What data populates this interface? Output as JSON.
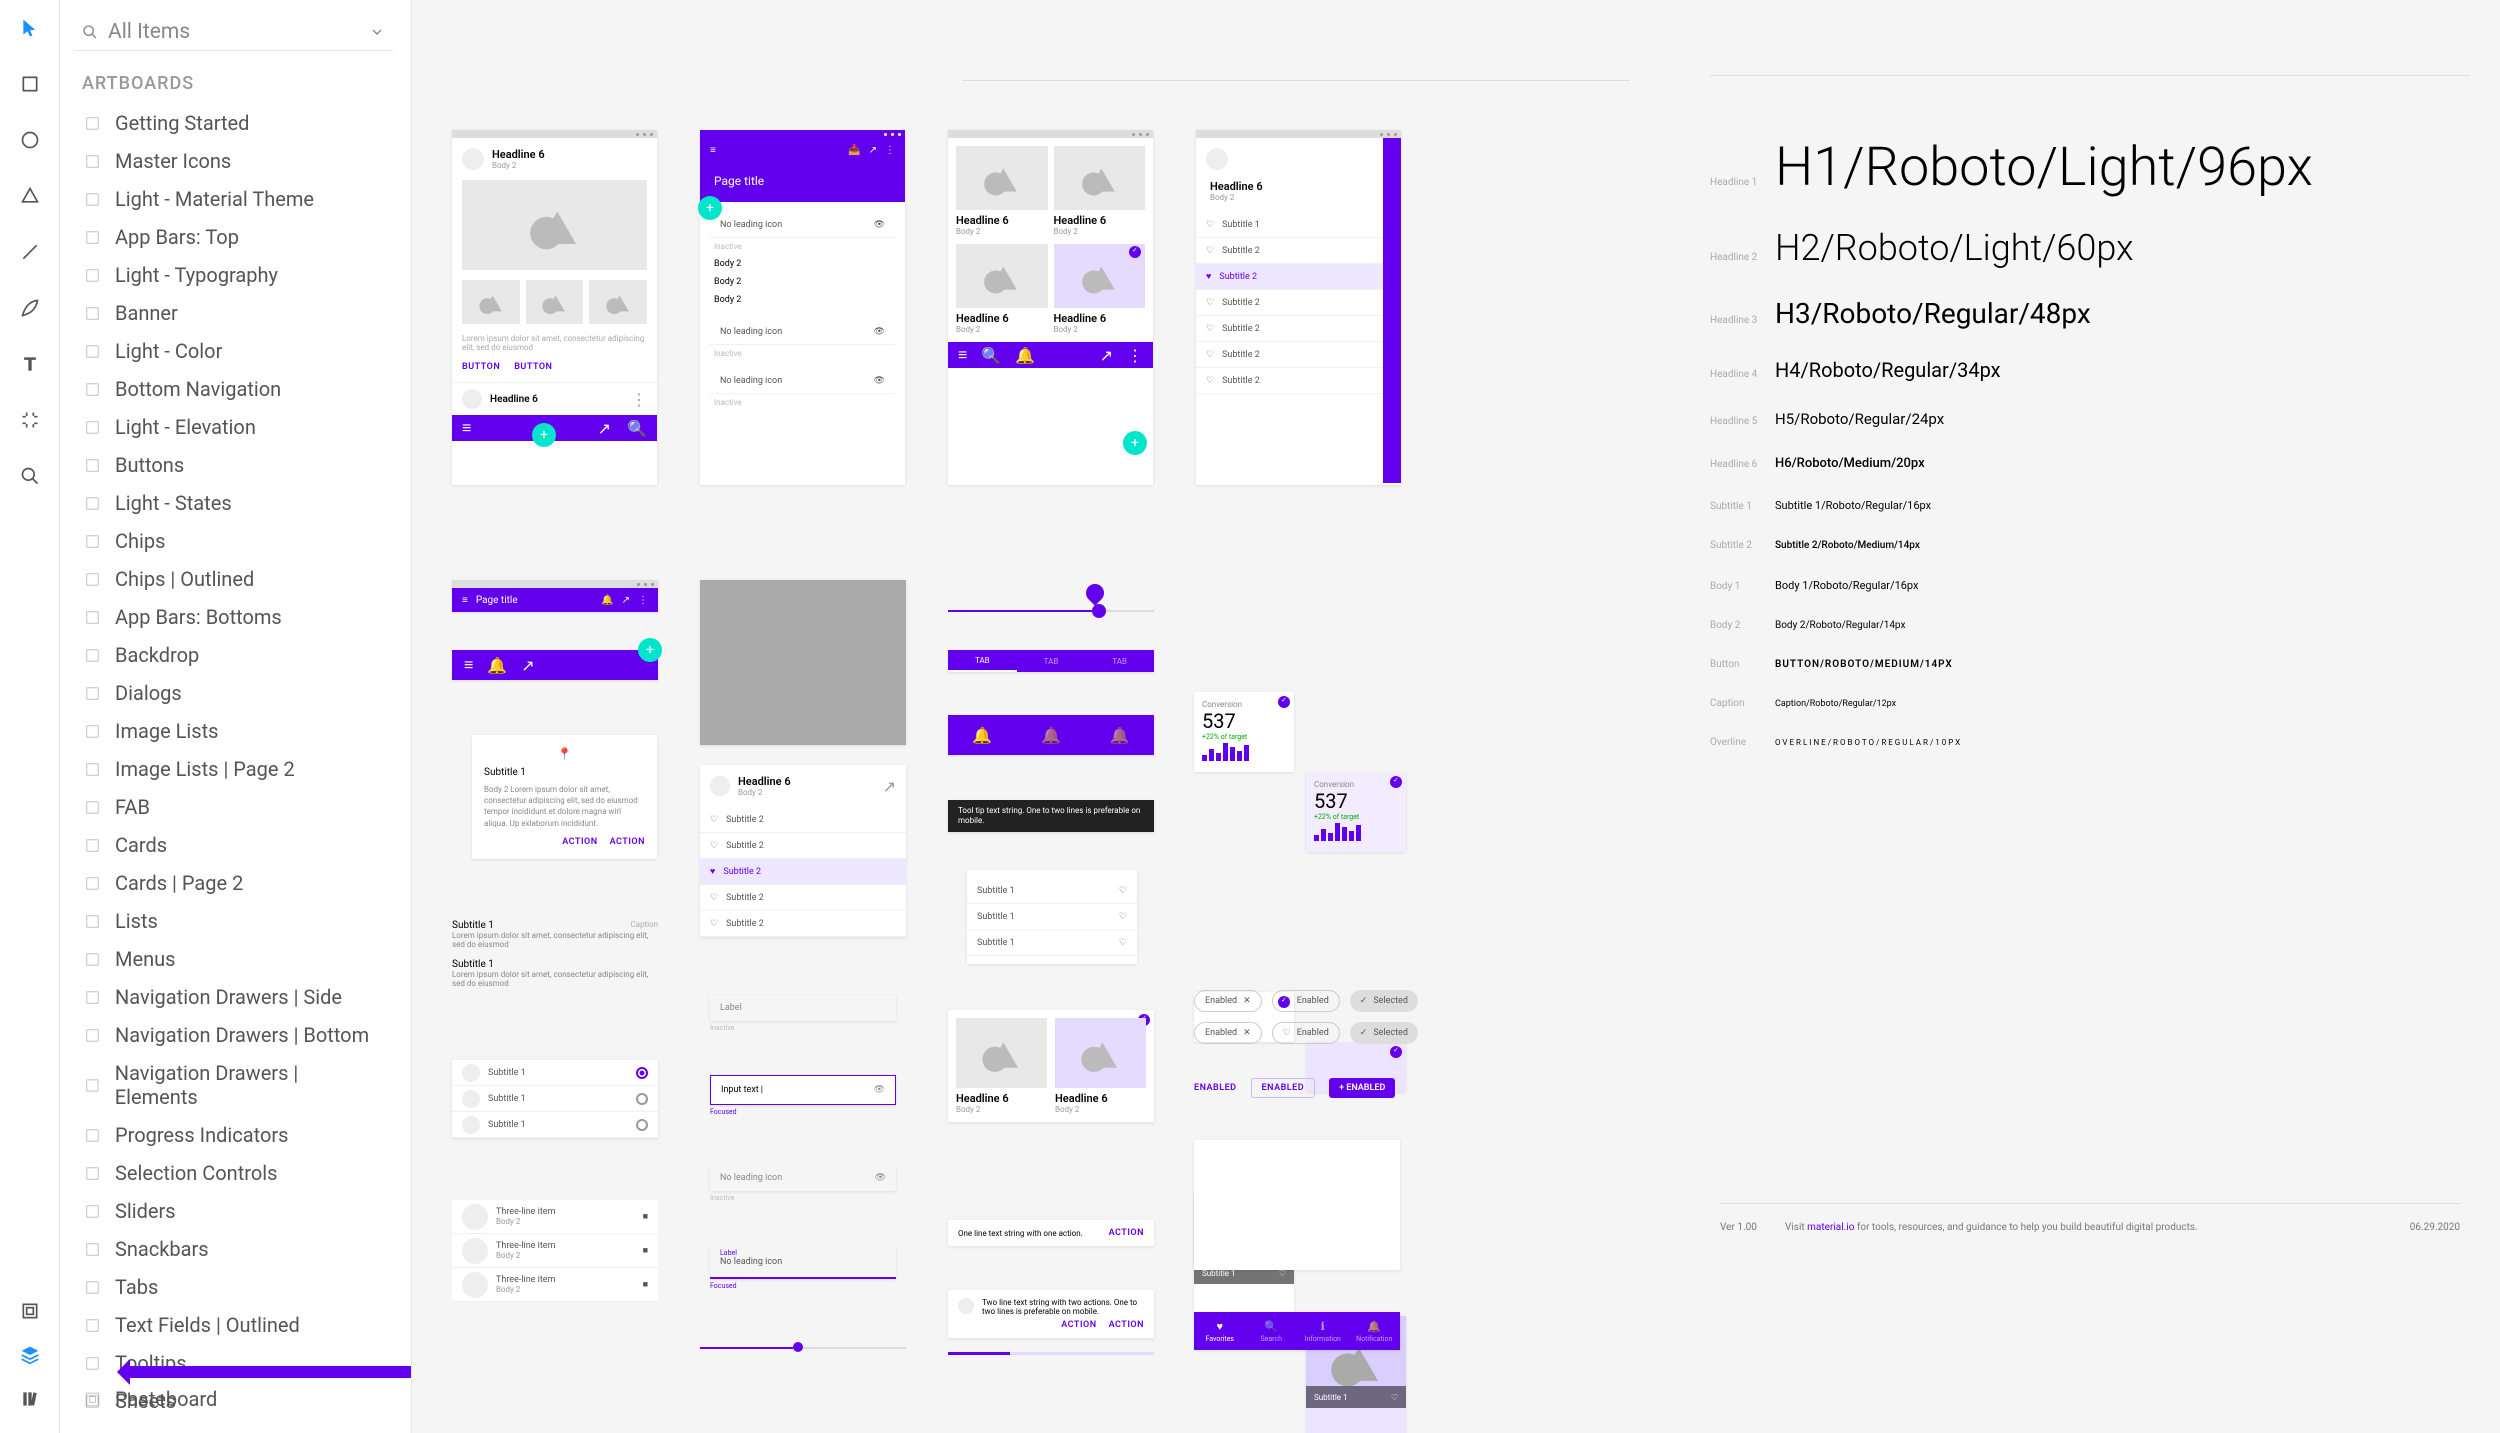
{
  "search_placeholder": "All Items",
  "section_label": "ARTBOARDS",
  "pasteboard_label": "Pasteboard",
  "artboards": [
    "Getting Started",
    "Master Icons",
    "Light - Material Theme",
    "App Bars: Top",
    "Light - Typography",
    "Banner",
    "Light - Color",
    "Bottom Navigation",
    "Light - Elevation",
    "Buttons",
    "Light - States",
    "Chips",
    "Chips | Outlined",
    "App Bars: Bottoms",
    "Backdrop",
    "Dialogs",
    "Image Lists",
    "Image Lists | Page 2",
    "FAB",
    "Cards",
    "Cards | Page 2",
    "Lists",
    "Menus",
    "Navigation Drawers | Side",
    "Navigation Drawers | Bottom",
    "Navigation Drawers | Elements",
    "Progress Indicators",
    "Selection Controls",
    "Sliders",
    "Snackbars",
    "Tabs",
    "Text Fields | Outlined",
    "Tooltips",
    "Sheets"
  ],
  "canvas": {
    "headline": "Headline 6",
    "body": "Body 2",
    "page_title": "Page title",
    "no_leading": "No leading icon",
    "inactive": "Inactive",
    "subtitle1": "Subtitle 1",
    "subtitle2": "Subtitle 2",
    "input_text": "Input text",
    "label": "Label",
    "focused": "Focused",
    "nolead": "No leading icon",
    "three_line": "Three-line item",
    "enabled": "Enabled",
    "selected": "Selected",
    "tab": "TAB",
    "action": "ACTION",
    "button": "BUTTON",
    "one_line_action": "One line text string with one action.",
    "two_line_action": "Two line text string with two actions. One to two lines is preferable on mobile.",
    "tooltip": "Tool tip text string. One to two lines is preferable on mobile.",
    "lorem": "Lorem ipsum dolor sit amet, consectetur adipiscing elit, sed do eiusmod",
    "lorem_long": "Body 2 Lorem ipsum dolor sit amet, consectetur adipiscing elit, sed do eiusmod tempor incididunt et dolore magna wirl aliqua. Up exlaborum incididunt.",
    "caption": "Caption",
    "conversion": "Conversion",
    "big_num": "537",
    "target": "+22% of target",
    "spark": [
      30,
      60,
      40,
      90,
      70,
      50,
      80
    ],
    "nav_items": [
      "Favorites",
      "Search",
      "Information",
      "Notification"
    ],
    "enabled_upper": "ENABLED",
    "plus_enabled": "+ ENABLED"
  },
  "typography": {
    "rows": [
      {
        "lab": "Headline 1",
        "txt": "H1/Roboto/Light/96px",
        "size": "54px",
        "weight": "300"
      },
      {
        "lab": "Headline 2",
        "txt": "H2/Roboto/Light/60px",
        "size": "36px",
        "weight": "300"
      },
      {
        "lab": "Headline 3",
        "txt": "H3/Roboto/Regular/48px",
        "size": "28px",
        "weight": "400"
      },
      {
        "lab": "Headline 4",
        "txt": "H4/Roboto/Regular/34px",
        "size": "20px",
        "weight": "400"
      },
      {
        "lab": "Headline 5",
        "txt": "H5/Roboto/Regular/24px",
        "size": "15px",
        "weight": "400"
      },
      {
        "lab": "Headline 6",
        "txt": "H6/Roboto/Medium/20px",
        "size": "13px",
        "weight": "500"
      },
      {
        "lab": "Subtitle 1",
        "txt": "Subtitle 1/Roboto/Regular/16px",
        "size": "11px",
        "weight": "400"
      },
      {
        "lab": "Subtitle 2",
        "txt": "Subtitle 2/Roboto/Medium/14px",
        "size": "10px",
        "weight": "500"
      },
      {
        "lab": "Body 1",
        "txt": "Body 1/Roboto/Regular/16px",
        "size": "11px",
        "weight": "400"
      },
      {
        "lab": "Body 2",
        "txt": "Body 2/Roboto/Regular/14px",
        "size": "10px",
        "weight": "400"
      },
      {
        "lab": "Button",
        "txt": "BUTTON/ROBOTO/MEDIUM/14PX",
        "size": "10px",
        "weight": "600",
        "ls": "1px"
      },
      {
        "lab": "Caption",
        "txt": "Caption/Roboto/Regular/12px",
        "size": "9px",
        "weight": "400"
      },
      {
        "lab": "Overline",
        "txt": "OVERLINE/ROBOTO/REGULAR/10PX",
        "size": "8px",
        "weight": "400",
        "ls": "2px"
      }
    ],
    "ver": "Ver 1.00",
    "visit": "Visit ",
    "link": "material.io",
    "visit_tail": " for tools, resources, and guidance to help you build beautiful digital products.",
    "date": "06.29.2020"
  }
}
